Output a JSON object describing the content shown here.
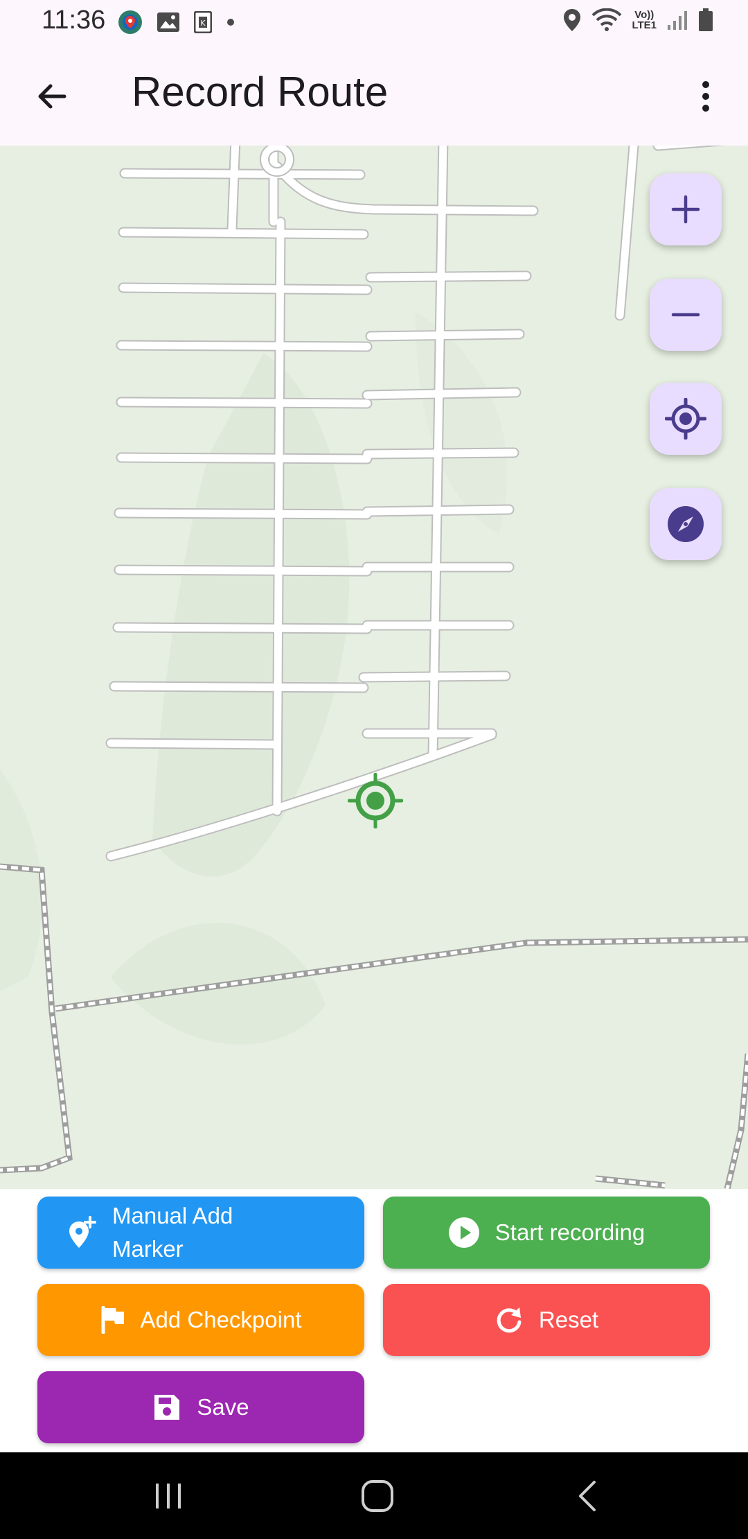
{
  "status_bar": {
    "time": "11:36",
    "left_icons": [
      "app-notification-icon",
      "image-icon",
      "k-app-icon",
      "dot-icon"
    ],
    "right_icons": [
      "location-icon",
      "wifi-icon",
      "volte-icon",
      "signal-icon",
      "battery-icon"
    ],
    "volte_top": "Vo))",
    "volte_bottom": "LTE1"
  },
  "app_bar": {
    "title": "Record Route",
    "back_icon": "arrow-back-icon",
    "menu_icon": "more-vert-icon"
  },
  "map": {
    "controls": [
      "zoom-in-icon",
      "zoom-out-icon",
      "my-location-icon",
      "compass-icon"
    ],
    "location_marker_color": "#43a047"
  },
  "actions": {
    "manual_add_marker": "Manual Add Marker",
    "start_recording": "Start recording",
    "add_checkpoint": "Add Checkpoint",
    "reset": "Reset",
    "save": "Save"
  },
  "colors": {
    "manual_add_marker": "#2196f3",
    "start_recording": "#4caf50",
    "add_checkpoint": "#ff9800",
    "reset": "#fa5252",
    "save": "#9c27b0",
    "fab_background": "#e9ddff",
    "fab_icon": "#4a3c8c"
  },
  "nav_bar": {
    "items": [
      "recents-icon",
      "home-icon",
      "back-icon"
    ]
  }
}
